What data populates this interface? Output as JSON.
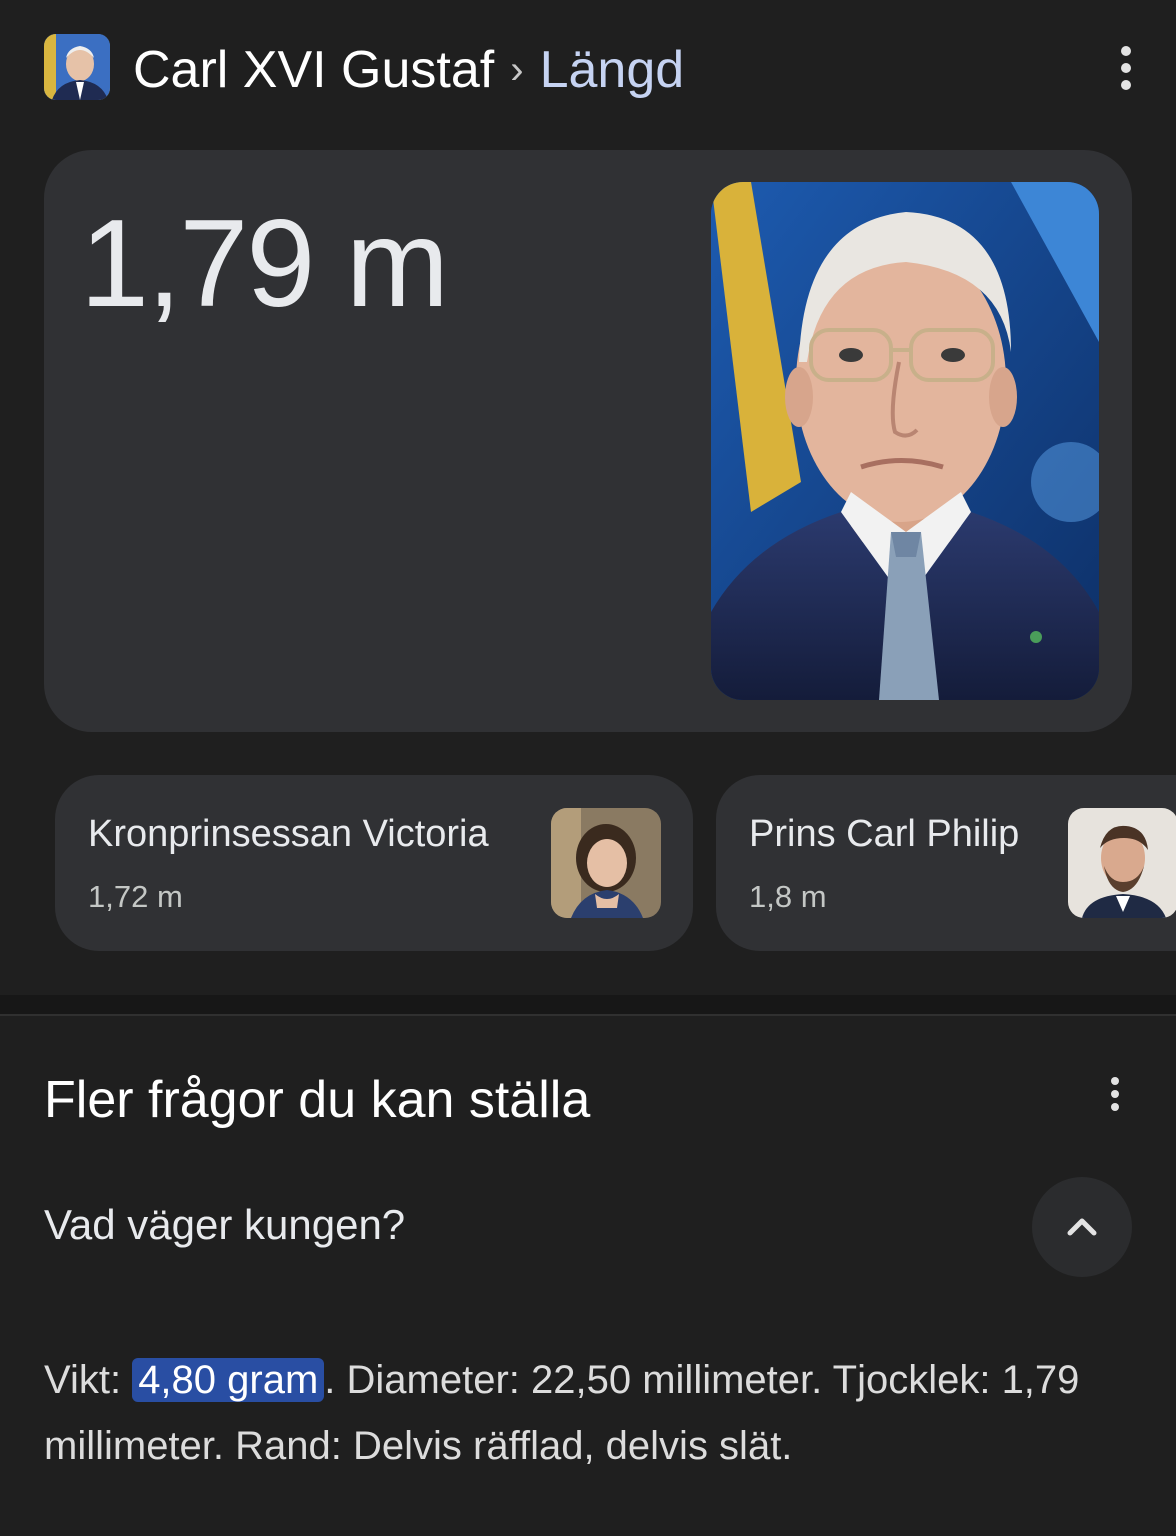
{
  "header": {
    "entity": "Carl XVI Gustaf",
    "separator": "›",
    "attribute": "Längd",
    "avatar_icon": "entity-avatar-icon",
    "menu_icon": "more-vert-icon"
  },
  "answer": {
    "value": "1,79 m",
    "photo_icon": "portrait-photo"
  },
  "related": [
    {
      "name": "Kronprinsessan Victoria",
      "value": "1,72 m"
    },
    {
      "name": "Prins Carl Philip",
      "value": "1,8 m"
    }
  ],
  "people_also_ask": {
    "title": "Fler frågor du kan ställa",
    "menu_icon": "more-vert-icon",
    "question": "Vad väger kungen?",
    "toggle_icon": "chevron-up-icon",
    "answer": {
      "label": "Vikt: ",
      "highlight": "4,80 gram",
      "rest": ". Diameter: 22,50 millimeter. Tjocklek: 1,79 millimeter. Rand: Delvis räfflad, delvis slät."
    }
  },
  "colors": {
    "background": "#1f1f1f",
    "card": "#303134",
    "accent_text": "#c6d3f2",
    "highlight": "#294ea3"
  }
}
